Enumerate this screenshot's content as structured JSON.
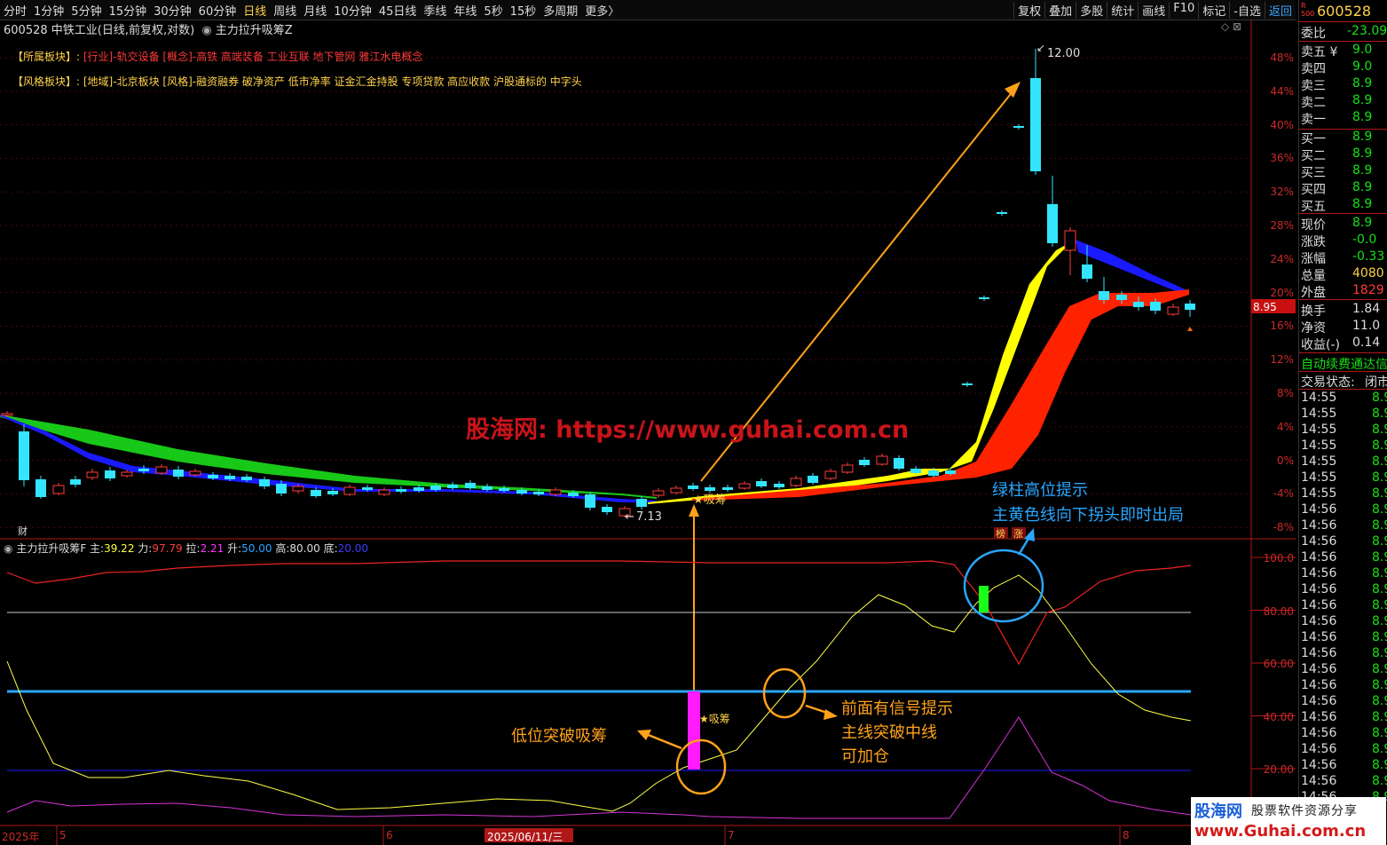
{
  "toolbar": {
    "tabs": [
      "分时",
      "1分钟",
      "5分钟",
      "15分钟",
      "30分钟",
      "60分钟",
      "日线",
      "周线",
      "月线",
      "10分钟",
      "45日线",
      "季线",
      "年线",
      "5秒",
      "15秒",
      "多周期",
      "更多〉"
    ],
    "active_tab": "日线",
    "right_buttons": [
      "复权",
      "叠加",
      "多股",
      "统计",
      "画线",
      "F10",
      "标记",
      "-自选",
      "返回"
    ]
  },
  "chart": {
    "title": "600528 中铁工业(日线,前复权,对数)",
    "indicator_name": "主力拉升吸筹Z",
    "sector_label": "【所属板块】:",
    "sector_value": "[行业]-轨交设备 [概念]-高铁 高端装备 工业互联 地下管网 雅江水电概念",
    "style_label": "【风格板块】:",
    "style_value": "[地域]-北京板块 [风格]-融资融券 破净资产 低市净率 证金汇金持股 专项贷款 高应收款 沪股通标的 中字头",
    "watermark": "股海网: https://www.guhai.com.cn",
    "high_label": "12.00",
    "low_label": "7.13",
    "price_tag": "8.95",
    "xichou_label": "★吸筹",
    "cai_label": "财",
    "bang_label": "榜",
    "zhang_label": "涨",
    "y_labels": [
      "48%",
      "44%",
      "40%",
      "36%",
      "32%",
      "28%",
      "24%",
      "20%",
      "16%",
      "12%",
      "8%",
      "4%",
      "0%",
      "-4%",
      "-8%"
    ]
  },
  "indicator": {
    "name": "主力拉升吸筹F",
    "zhu_label": "主:",
    "zhu_value": "39.22",
    "li_label": "力:",
    "li_value": "97.79",
    "la_label": "拉:",
    "la_value": "2.21",
    "sheng_label": "升:",
    "sheng_value": "50.00",
    "gao_label": "高:",
    "gao_value": "80.00",
    "di_label": "底:",
    "di_value": "20.00",
    "y_labels": [
      "100.0",
      "80.00",
      "60.00",
      "40.00",
      "20.00"
    ],
    "xichou_label": "★吸筹"
  },
  "annotations": {
    "green_bar_1": "绿柱高位提示",
    "green_bar_2": "主黄色线向下拐头即时出局",
    "low_breakout": "低位突破吸筹",
    "signal_1": "前面有信号提示",
    "signal_2": "主线突破中线",
    "signal_3": "可加仓"
  },
  "dates": {
    "year": "2025年",
    "m5": "5",
    "m6": "6",
    "current": "2025/06/11/三",
    "m7": "7",
    "m8": "8"
  },
  "right_panel": {
    "code": "600528",
    "webi_label": "委比",
    "webi_value": "-23.09",
    "sell": [
      {
        "label": "卖五 ¥",
        "value": "9.0"
      },
      {
        "label": "卖四",
        "value": "9.0"
      },
      {
        "label": "卖三",
        "value": "8.9"
      },
      {
        "label": "卖二",
        "value": "8.9"
      },
      {
        "label": "卖一",
        "value": "8.9"
      }
    ],
    "buy": [
      {
        "label": "买一",
        "value": "8.9"
      },
      {
        "label": "买二",
        "value": "8.9"
      },
      {
        "label": "买三",
        "value": "8.9"
      },
      {
        "label": "买四",
        "value": "8.9"
      },
      {
        "label": "买五",
        "value": "8.9"
      }
    ],
    "stats": [
      {
        "label": "现价",
        "value": "8.9"
      },
      {
        "label": "涨跌",
        "value": "-0.0"
      },
      {
        "label": "涨幅",
        "value": "-0.33"
      },
      {
        "label": "总量",
        "value": "4080"
      },
      {
        "label": "外盘",
        "value": "1829"
      }
    ],
    "stats2": [
      {
        "label": "换手",
        "value": "1.84"
      },
      {
        "label": "净资",
        "value": "11.0"
      },
      {
        "label": "收益(-)",
        "value": "0.14"
      }
    ],
    "auto_text": "自动续费通达信",
    "trade_label": "交易状态:",
    "trade_value": "闭市",
    "ticks": [
      "14:55",
      "14:55",
      "14:55",
      "14:55",
      "14:55",
      "14:55",
      "14:55",
      "14:56",
      "14:56",
      "14:56",
      "14:56",
      "14:56",
      "14:56",
      "14:56",
      "14:56",
      "14:56",
      "14:56",
      "14:56",
      "14:56",
      "14:56",
      "14:56",
      "14:56",
      "14:56",
      "14:56",
      "14:56",
      "14:56"
    ],
    "tick_value": "8.9"
  },
  "logo": {
    "name": "股海网",
    "tagline": "股票软件资源分享",
    "url": "www.Guhai.com.cn"
  },
  "colors": {
    "up": "#ff3b3b",
    "down": "#33e5ff",
    "yellow": "#ffff00",
    "ma_red": "#ff2200",
    "ma_blue": "#1a1aff",
    "ma_green": "#18c818",
    "annotation_blue": "#2aa6ff",
    "annotation_orange": "#ffa21a"
  }
}
